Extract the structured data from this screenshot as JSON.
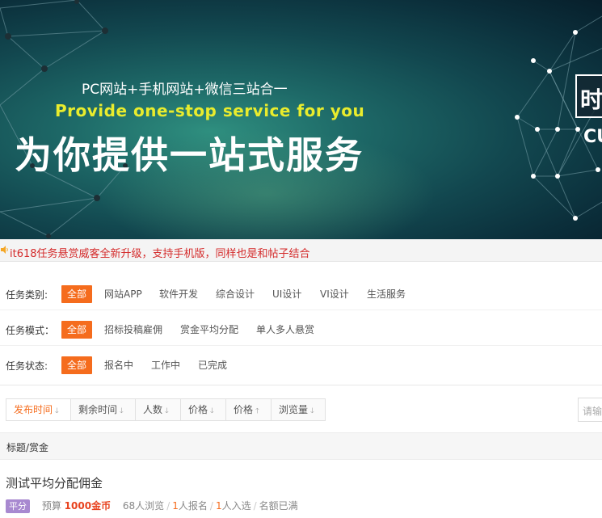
{
  "banner": {
    "line1": "PC网站+手机网站+微信三站合一",
    "line2": "Provide one-stop service for you",
    "line3": "为你提供一站式服务",
    "badge": "时",
    "badge2": "CU"
  },
  "notice": {
    "icon": "speaker-icon",
    "text": "it618任务悬赏威客全新升级，支持手机版，同样也是和帖子结合"
  },
  "filters": {
    "category": {
      "label": "任务类别:",
      "options": [
        "全部",
        "网站APP",
        "软件开发",
        "综合设计",
        "UI设计",
        "VI设计",
        "生活服务"
      ]
    },
    "mode": {
      "label": "任务模式：",
      "options": [
        "全部",
        "招标投稿雇佣",
        "赏金平均分配",
        "单人多人悬赏"
      ]
    },
    "status": {
      "label": "任务状态:",
      "options": [
        "全部",
        "报名中",
        "工作中",
        "已完成"
      ]
    }
  },
  "sort": {
    "buttons": [
      {
        "label": "发布时间",
        "arrow": "down"
      },
      {
        "label": "剩余时间",
        "arrow": "down"
      },
      {
        "label": "人数",
        "arrow": "down"
      },
      {
        "label": "价格",
        "arrow": "down"
      },
      {
        "label": "价格",
        "arrow": "up"
      },
      {
        "label": "浏览量",
        "arrow": "down"
      }
    ],
    "search_placeholder": "请输"
  },
  "list": {
    "header": "标题/赏金",
    "items": [
      {
        "title": "测试平均分配佣金",
        "tag": "平分",
        "budget_label": "预算",
        "budget_value": "1000金币",
        "views": "68人浏览",
        "signup_num": "1",
        "signup_text": "人报名",
        "selected_num": "1",
        "selected_text": "人入选",
        "status": "名额已满"
      }
    ]
  },
  "colors": {
    "accent": "#f56c1d",
    "notice_text": "#d42b2b",
    "tag": "#a889d0"
  }
}
